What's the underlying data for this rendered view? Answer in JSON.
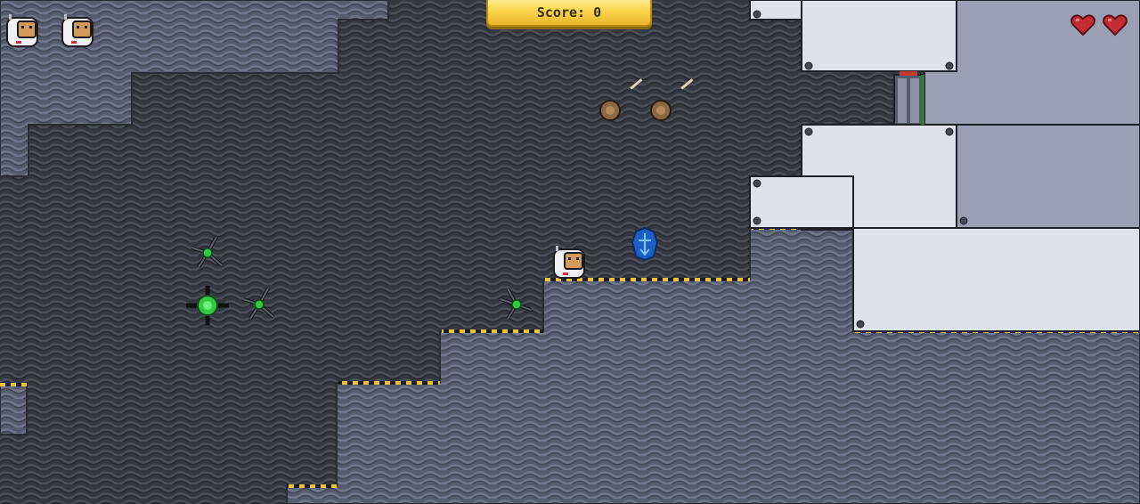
{
  "hud": {
    "score_label": "Score:",
    "score_value": "0",
    "lives_count": 2,
    "health_count": 2,
    "heart_color": "#c62c36",
    "score_bg": "#fbd54a"
  },
  "icons": {
    "life": "astronaut-head-icon",
    "health": "heart-icon",
    "player": "astronaut-player",
    "enemy": "spider-drone-enemy",
    "hazard": "spore-cannon",
    "pickup": "shield-badge-powerup",
    "exit": "airlock-door"
  },
  "colors": {
    "dark_rock": "#3c3f48",
    "light_rock": "#5b6072",
    "panel": "#dfe2ea",
    "panel_dark": "#9aa0b4",
    "hazard_stripe": "#f0c430",
    "enemy_glow": "#32c840"
  }
}
